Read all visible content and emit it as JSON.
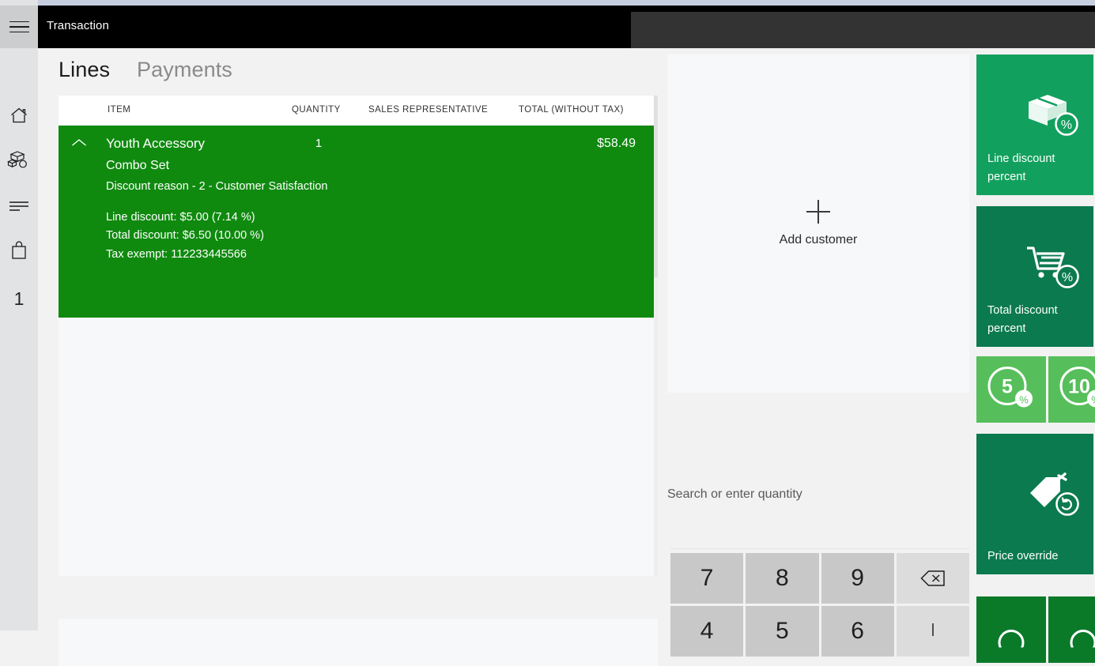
{
  "header": {
    "title": "Transaction",
    "menu_icon": "hamburger-icon"
  },
  "sidebar": {
    "items": [
      {
        "icon": "home-icon",
        "name": "home"
      },
      {
        "icon": "products-icon",
        "name": "products"
      },
      {
        "icon": "lines-icon",
        "name": "lines"
      },
      {
        "icon": "bag-icon",
        "name": "bag"
      }
    ],
    "counter": "1"
  },
  "tabs": [
    {
      "label": "Lines",
      "active": true
    },
    {
      "label": "Payments",
      "active": false
    }
  ],
  "lines_table": {
    "columns": [
      "ITEM",
      "QUANTITY",
      "SALES REPRESENTATIVE",
      "TOTAL (WITHOUT TAX)"
    ],
    "rows": [
      {
        "expand_icon": "chevron-up-icon",
        "item": "Youth Accessory",
        "variant": "Combo Set",
        "quantity": "1",
        "sales_representative": "",
        "total": "$58.49",
        "discount_reason": "Discount reason - 2 - Customer Satisfaction",
        "line_discount": "Line discount: $5.00 (7.14 %)",
        "total_discount": "Total discount: $6.50 (10.00 %)",
        "tax_exempt": "Tax exempt: 112233445566",
        "selected_color": "#0f8a0f"
      }
    ]
  },
  "customer": {
    "add_label": "Add customer",
    "add_icon": "plus-icon"
  },
  "search": {
    "value": "",
    "placeholder": "Search or enter quantity"
  },
  "numpad": {
    "keys": [
      {
        "label": "7",
        "type": "digit"
      },
      {
        "label": "8",
        "type": "digit"
      },
      {
        "label": "9",
        "type": "digit"
      },
      {
        "label": "",
        "type": "backspace",
        "icon": "backspace-icon"
      },
      {
        "label": "4",
        "type": "digit"
      },
      {
        "label": "5",
        "type": "digit"
      },
      {
        "label": "6",
        "type": "digit"
      },
      {
        "label": "",
        "type": "enter",
        "icon": "enter-icon"
      }
    ]
  },
  "action_tiles": [
    {
      "label": "Line discount percent",
      "icon": "box-percent-icon",
      "color": "#12a05e"
    },
    {
      "label": "Total discount percent",
      "icon": "cart-percent-icon",
      "color": "#0b7a4f"
    },
    {
      "label": "5",
      "icon": "percent-circle-icon",
      "color": "#56bf5b"
    },
    {
      "label": "10",
      "icon": "percent-circle-icon",
      "color": "#56bf5b"
    },
    {
      "label": "Price override",
      "icon": "tag-undo-icon",
      "color": "#0b7a4f"
    },
    {
      "label": "",
      "icon": "partial-tile-icon",
      "color": "#0a7a29"
    },
    {
      "label": "",
      "icon": "partial-tile-icon",
      "color": "#0a7a29"
    }
  ],
  "colors": {
    "accent_green": "#0f8a0f",
    "tile_green": "#12a05e",
    "tile_teal": "#0b7a4f",
    "tile_light_green": "#56bf5b",
    "tile_dark_green": "#0a7a29",
    "header_black": "#000000",
    "header_panel": "#333333",
    "top_strip": "#c5cfe0"
  }
}
